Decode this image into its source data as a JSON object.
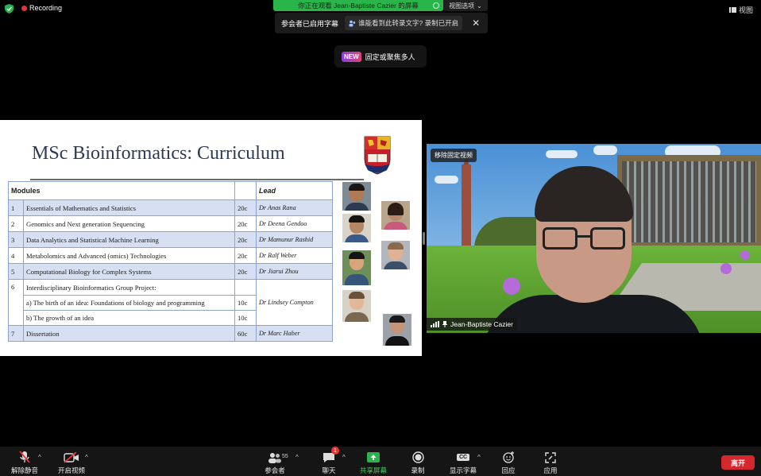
{
  "topbar": {
    "recording_label": "Recording",
    "share_banner": "你正在观看 Jean-Baptiste Cazier 的屏幕",
    "view_options": "视图选项",
    "view_button": "视图"
  },
  "caption_bar": {
    "captions_enabled": "参会者已启用字幕",
    "question": "谁能看到此转录文字? 录制已开启"
  },
  "notice": {
    "badge": "NEW",
    "text": "固定或聚焦多人"
  },
  "slide": {
    "title": "MSc Bioinformatics: Curriculum",
    "headers": {
      "modules": "Modules",
      "lead": "Lead"
    },
    "rows": [
      {
        "num": "1",
        "module": "Essentials of Mathematics and Statistics",
        "credits": "20c",
        "lead": "Dr Anas Rana"
      },
      {
        "num": "2",
        "module": "Genomics and Next generation Sequencing",
        "credits": "20c",
        "lead": "Dr Deena Gendoo"
      },
      {
        "num": "3",
        "module": "Data Analytics and Statistical Machine Learning",
        "credits": "20c",
        "lead": "Dr Mamunur Rashid"
      },
      {
        "num": "4",
        "module": "Metabolomics and Advanced (omics) Technologies",
        "credits": "20c",
        "lead": "Dr Ralf Weber"
      },
      {
        "num": "5",
        "module": "Computational Biology for Complex Systems",
        "credits": "20c",
        "lead": "Dr Jiarui Zhou"
      },
      {
        "num": "6",
        "module": "Interdisciplinary Bioinformatics Group Project:",
        "credits": "",
        "lead": ""
      },
      {
        "num": "",
        "module": "a) The birth of an idea: Foundations of biology and programming",
        "credits": "10c",
        "lead": "Dr Lindsey Compton"
      },
      {
        "num": "",
        "module": "b) The growth of an idea",
        "credits": "10c",
        "lead": ""
      },
      {
        "num": "7",
        "module": "Dissertation",
        "credits": "60c",
        "lead": "Dr Marc Haber"
      }
    ]
  },
  "video": {
    "unpin_label": "移除固定视频",
    "participant_name": "Jean-Baptiste Cazier"
  },
  "toolbar": {
    "unmute": "解除静音",
    "start_video": "开启视频",
    "participants": "参会者",
    "participant_count": "55",
    "chat": "聊天",
    "chat_badge": "1",
    "share_screen": "共享屏幕",
    "record": "录制",
    "captions": "显示字幕",
    "captions_icon_text": "CC",
    "reactions": "回应",
    "apps": "应用",
    "leave": "离开"
  },
  "colors": {
    "share_banner": "#29b549",
    "leave_button": "#d6262e",
    "table_alt_row": "#d6e0f2",
    "slide_title": "#2d3a56"
  }
}
